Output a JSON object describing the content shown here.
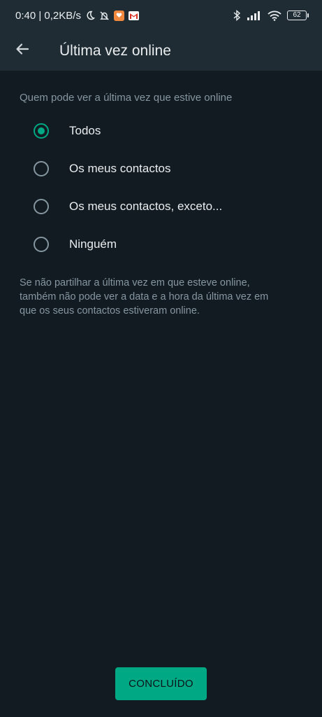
{
  "status_bar": {
    "time_speed": "0:40 | 0,2KB/s",
    "battery": "62",
    "colors": {
      "badge1": "#f0883e",
      "badge2": "#ffffff"
    }
  },
  "header": {
    "title": "Última vez online",
    "back_icon": "arrow-left-icon"
  },
  "main": {
    "section_label": "Quem pode ver a última vez que estive online",
    "options": [
      {
        "label": "Todos",
        "selected": true
      },
      {
        "label": "Os meus contactos",
        "selected": false
      },
      {
        "label": "Os meus contactos, exceto...",
        "selected": false
      },
      {
        "label": "Ninguém",
        "selected": false
      }
    ],
    "note": "Se não partilhar a última vez em que esteve online, também não pode ver a data e a hora da última vez em que os seus contactos estiveram online."
  },
  "footer": {
    "done_label": "CONCLUÍDO"
  },
  "colors": {
    "accent": "#00a884",
    "background": "#121b22",
    "bar": "#1f2c34",
    "muted_text": "#8696a0"
  }
}
